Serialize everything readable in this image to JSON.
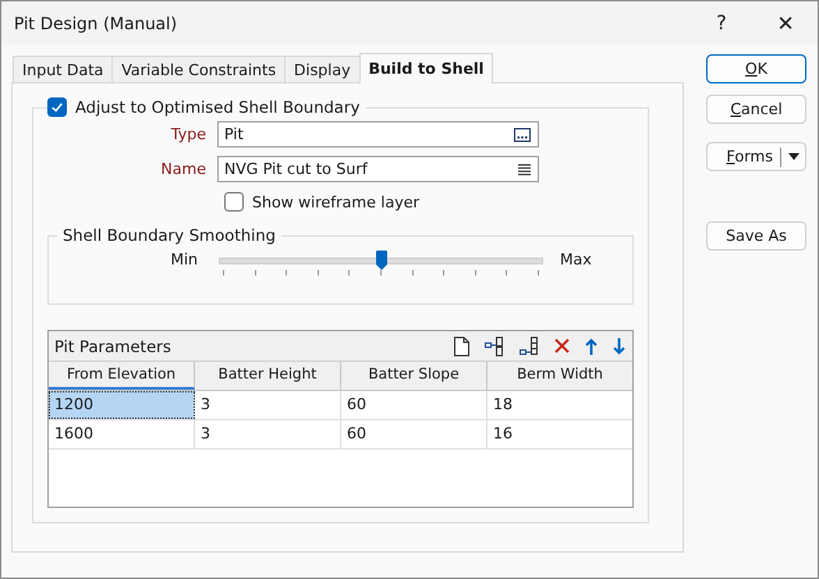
{
  "window": {
    "title": "Pit Design (Manual)",
    "help": "?",
    "close": "✕"
  },
  "tabs": [
    {
      "label": "Input Data",
      "selected": false
    },
    {
      "label": "Variable Constraints",
      "selected": false
    },
    {
      "label": "Display",
      "selected": false
    },
    {
      "label": "Build to Shell",
      "selected": true
    }
  ],
  "adjust_group": {
    "label": "Adjust to Optimised Shell Boundary",
    "checked": true
  },
  "fields": [
    {
      "label": "Type",
      "value": "Pit",
      "kind": "browse"
    },
    {
      "label": "Name",
      "value": "NVG Pit cut to Surf",
      "kind": "list"
    }
  ],
  "wireframe": {
    "label": "Show wireframe layer",
    "checked": false
  },
  "smoothing": {
    "title": "Shell Boundary Smoothing",
    "min_label": "Min",
    "max_label": "Max",
    "level": 0.5
  },
  "table": {
    "title": "Pit Parameters",
    "columns": [
      "From Elevation",
      "Batter Height",
      "Batter Slope",
      "Berm Width"
    ],
    "rows": [
      {
        "cells": [
          "1200",
          "3",
          "60",
          "18"
        ],
        "selected": true
      },
      {
        "cells": [
          "1600",
          "3",
          "60",
          "16"
        ],
        "selected": false
      }
    ]
  },
  "buttons": [
    {
      "label": "OK",
      "kind": "default"
    },
    {
      "label": "Cancel",
      "kind": "plain"
    },
    {
      "label": "Forms",
      "kind": "split"
    },
    {
      "label": "Save As",
      "kind": "plain"
    }
  ]
}
